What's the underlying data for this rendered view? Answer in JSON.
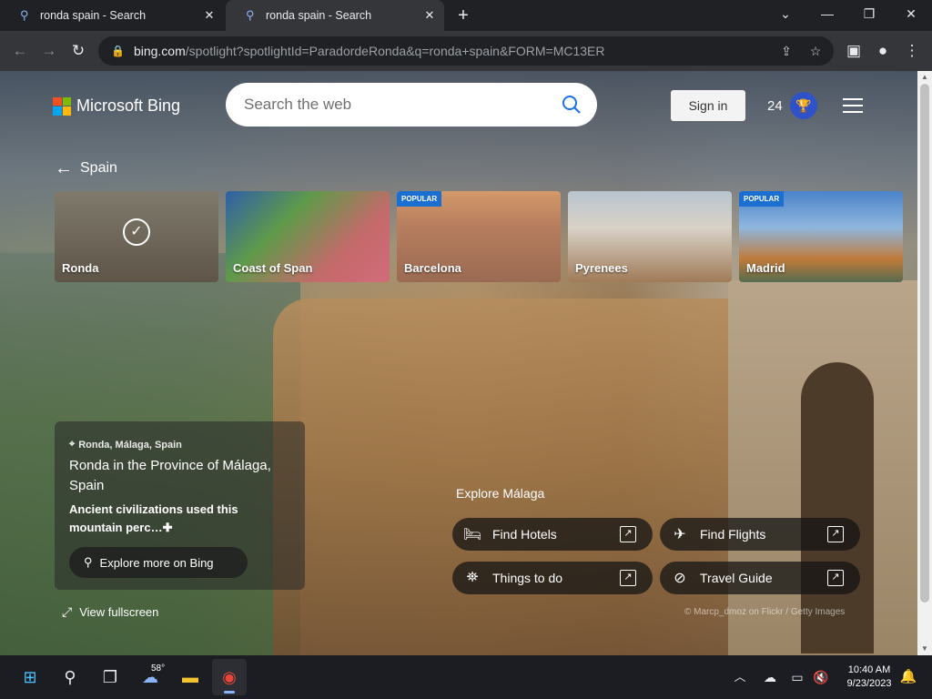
{
  "browser": {
    "tabs": [
      {
        "title": "ronda spain - Search"
      },
      {
        "title": "ronda spain - Search"
      }
    ],
    "url_host": "bing.com",
    "url_rest": "/spotlight?spotlightId=ParadordeRonda&q=ronda+spain&FORM=MC13ER"
  },
  "bing": {
    "logo_text": "Microsoft Bing",
    "search_placeholder": "Search the web",
    "signin_label": "Sign in",
    "points": "24"
  },
  "breadcrumb": {
    "label": "Spain"
  },
  "cards": [
    {
      "title": "Ronda",
      "badge": "",
      "selected": true
    },
    {
      "title": "Coast of Span",
      "badge": "",
      "selected": false
    },
    {
      "title": "Barcelona",
      "badge": "POPULAR",
      "selected": false
    },
    {
      "title": "Pyrenees",
      "badge": "",
      "selected": false
    },
    {
      "title": "Madrid",
      "badge": "POPULAR",
      "selected": false
    }
  ],
  "info": {
    "location": "Ronda, Málaga, Spain",
    "headline": "Ronda in the Province of Málaga, Spain",
    "description": "Ancient civilizations used this mountain perc…",
    "explore_button": "Explore more on Bing",
    "fullscreen_label": "View fullscreen"
  },
  "explore": {
    "title": "Explore Málaga",
    "actions": [
      {
        "label": "Find Hotels"
      },
      {
        "label": "Find Flights"
      },
      {
        "label": "Things to do"
      },
      {
        "label": "Travel Guide"
      }
    ]
  },
  "credit": "© Marcp_dmoz on Flickr / Getty Images",
  "taskbar": {
    "weather_temp": "58°",
    "time": "10:40 AM",
    "date": "9/23/2023"
  },
  "colors": {
    "accent": "#1a73e8",
    "badge": "#1b6fd1",
    "rewards": "#2f52c9"
  }
}
